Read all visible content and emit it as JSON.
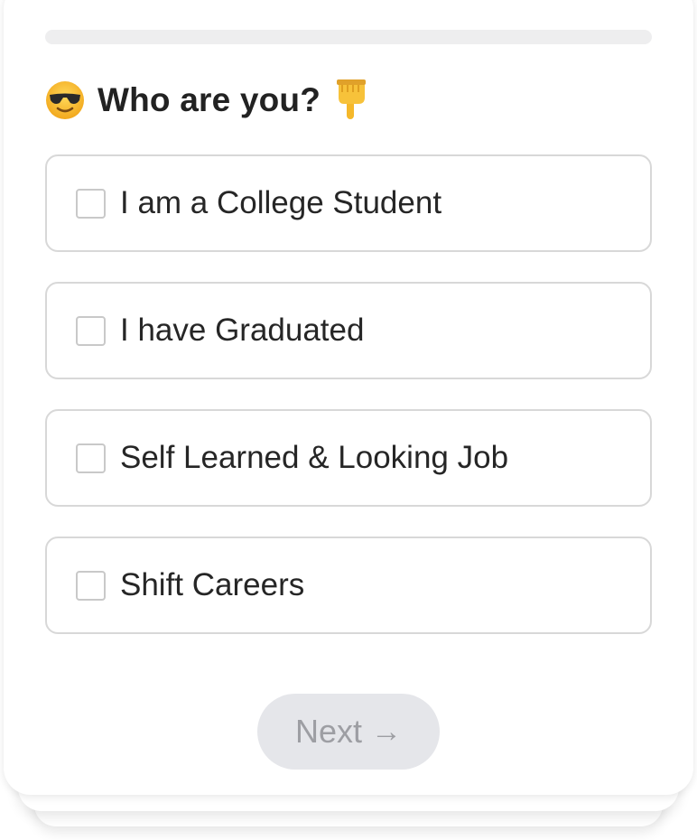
{
  "progress": {
    "value": 0
  },
  "question": {
    "text": "Who are you?",
    "leading_icon": "smiling-face-with-sunglasses-icon",
    "trailing_icon": "backhand-index-pointing-down-icon"
  },
  "options": [
    {
      "label": "I am a College Student",
      "checked": false
    },
    {
      "label": "I have Graduated",
      "checked": false
    },
    {
      "label": "Self Learned & Looking Job",
      "checked": false
    },
    {
      "label": "Shift Careers",
      "checked": false
    }
  ],
  "next_button": {
    "label": "Next",
    "icon": "arrow-right-icon",
    "arrow": "→",
    "disabled": true
  },
  "colors": {
    "border": "#d8d8d8",
    "text": "#222222",
    "button_bg": "#e5e6ea",
    "button_text": "#9d9ea3",
    "progress_track": "#eeeeef"
  }
}
